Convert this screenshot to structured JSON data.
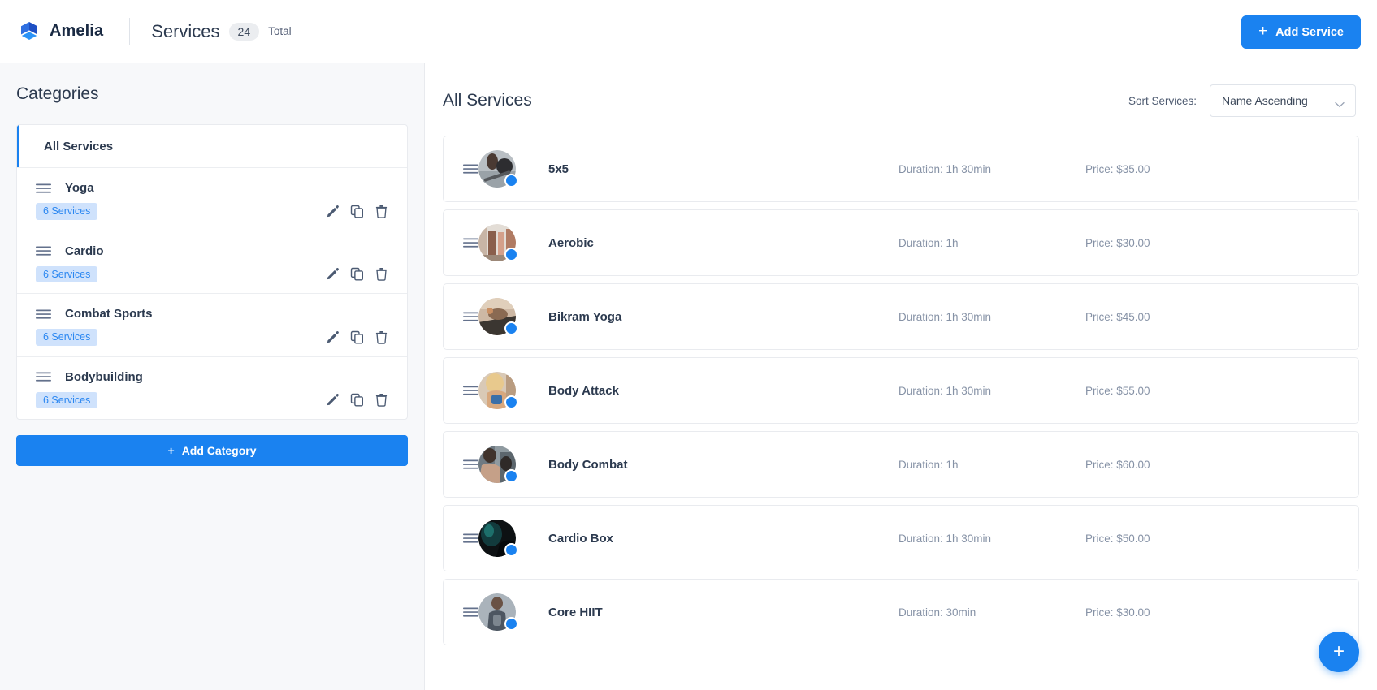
{
  "header": {
    "brand": "Amelia",
    "page_title": "Services",
    "count": "24",
    "count_label": "Total",
    "add_service_label": "Add Service",
    "plus": "+"
  },
  "sidebar": {
    "title": "Categories",
    "all_services_label": "All Services",
    "add_category_label": "Add Category",
    "plus": "+",
    "categories": [
      {
        "name": "Yoga",
        "services_badge": "6 Services"
      },
      {
        "name": "Cardio",
        "services_badge": "6 Services"
      },
      {
        "name": "Combat Sports",
        "services_badge": "6 Services"
      },
      {
        "name": "Bodybuilding",
        "services_badge": "6 Services"
      }
    ]
  },
  "main": {
    "title": "All Services",
    "sort_label": "Sort Services:",
    "sort_value": "Name Ascending",
    "fab_plus": "+",
    "services": [
      {
        "name": "5x5",
        "duration": "Duration: 1h 30min",
        "price": "Price: $35.00",
        "avatar_tone": "gym-barbell"
      },
      {
        "name": "Aerobic",
        "duration": "Duration: 1h",
        "price": "Price: $30.00",
        "avatar_tone": "aerobic-class"
      },
      {
        "name": "Bikram Yoga",
        "duration": "Duration: 1h 30min",
        "price": "Price: $45.00",
        "avatar_tone": "yoga-mat"
      },
      {
        "name": "Body Attack",
        "duration": "Duration: 1h 30min",
        "price": "Price: $55.00",
        "avatar_tone": "trainer-blonde"
      },
      {
        "name": "Body Combat",
        "duration": "Duration: 1h",
        "price": "Price: $60.00",
        "avatar_tone": "boxing-pair"
      },
      {
        "name": "Cardio Box",
        "duration": "Duration: 1h 30min",
        "price": "Price: $50.00",
        "avatar_tone": "dark-gloves"
      },
      {
        "name": "Core HIIT",
        "duration": "Duration: 30min",
        "price": "Price: $30.00",
        "avatar_tone": "hiit-grey"
      }
    ]
  },
  "colors": {
    "accent": "#1a82f0",
    "badge_bg": "#cfe2fc",
    "badge_text": "#2b87f1",
    "text_dark": "#2c3a4f",
    "text_muted": "#8692a6"
  }
}
